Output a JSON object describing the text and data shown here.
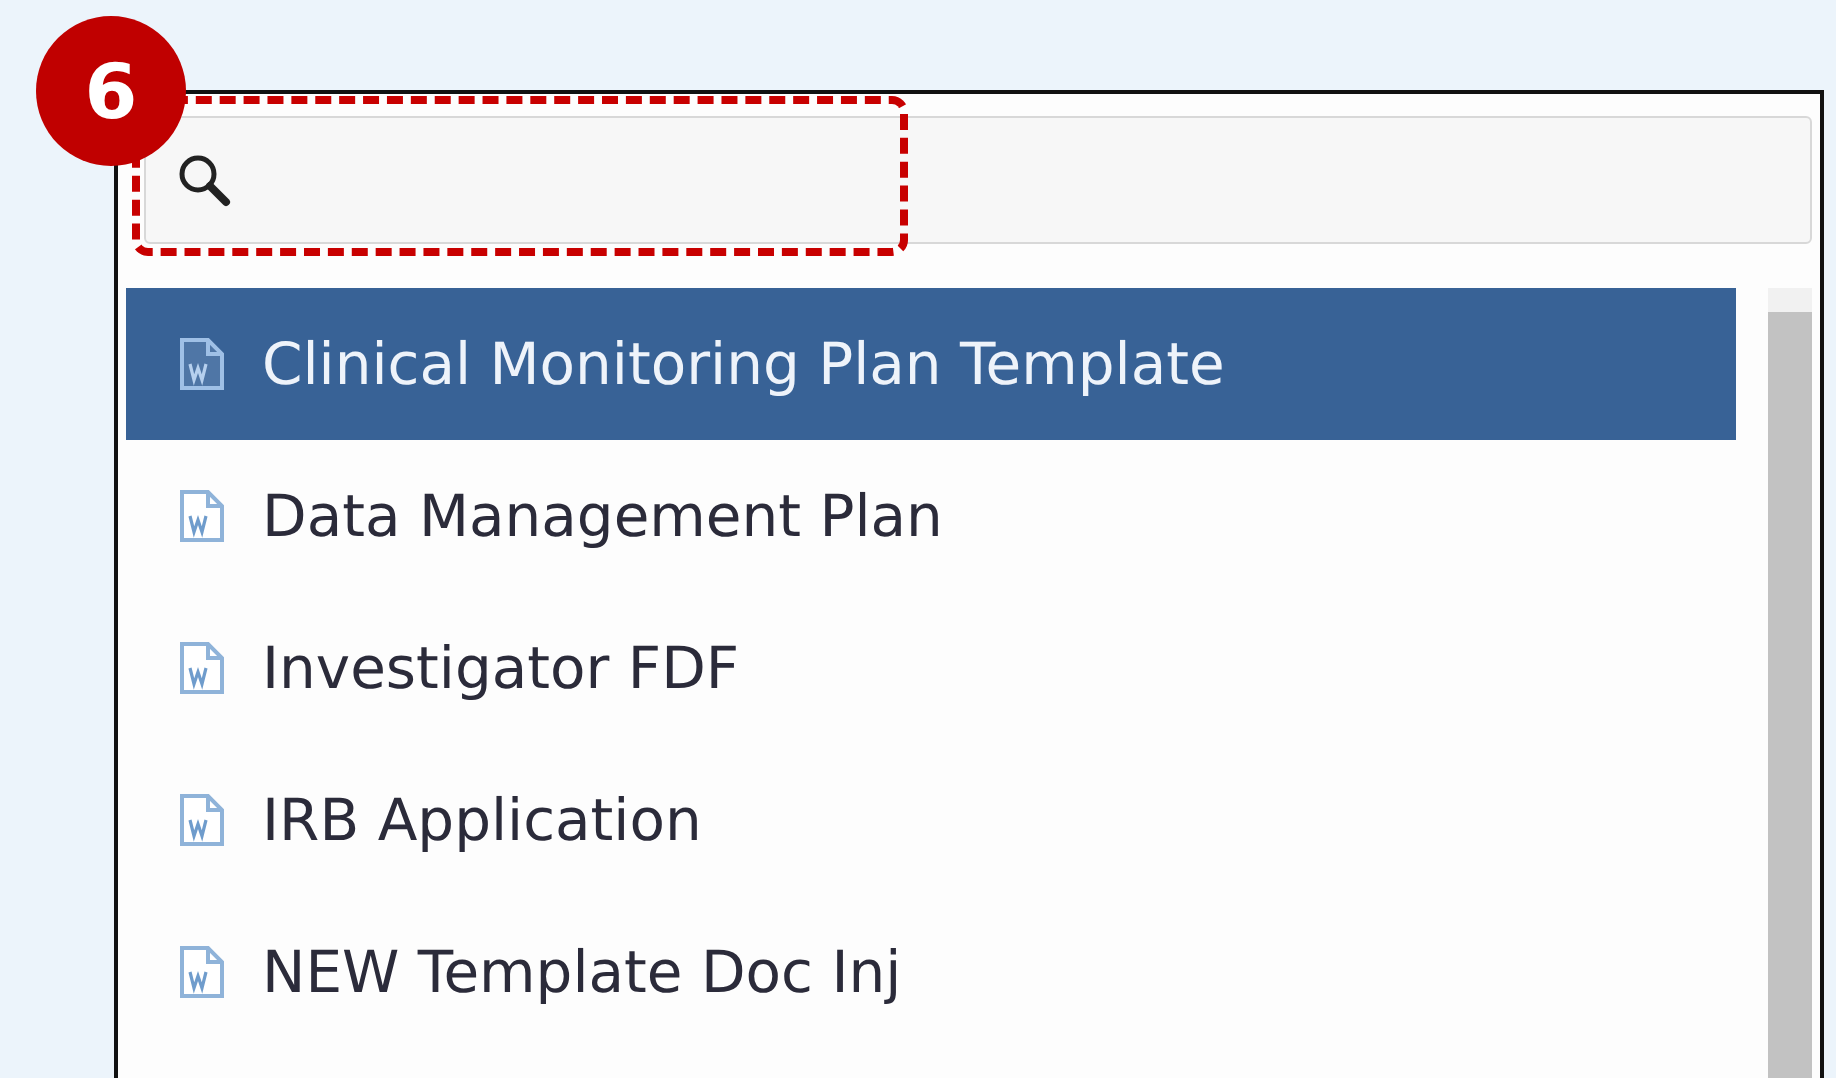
{
  "step_badge": "6",
  "search": {
    "highlighted": true
  },
  "items": [
    {
      "label": "Clinical Monitoring Plan Template",
      "selected": true
    },
    {
      "label": "Data Management Plan",
      "selected": false
    },
    {
      "label": "Investigator FDF",
      "selected": false
    },
    {
      "label": "IRB Application",
      "selected": false
    },
    {
      "label": "NEW Template Doc Inj",
      "selected": false
    }
  ]
}
